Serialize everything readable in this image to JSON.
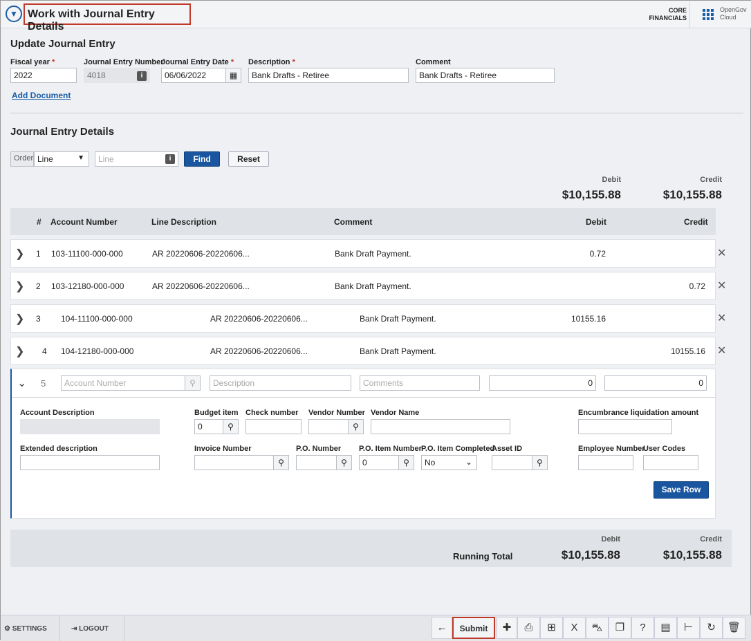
{
  "header": {
    "title": "Work with Journal Entry Details",
    "product_line1": "CORE",
    "product_line2": "FINANCIALS",
    "brand_line1": "OpenGov",
    "brand_line2": "Cloud"
  },
  "update": {
    "heading": "Update Journal Entry",
    "fiscal_year": {
      "label": "Fiscal year",
      "value": "2022"
    },
    "je_number": {
      "label": "Journal Entry Number",
      "value": "4018"
    },
    "je_date": {
      "label": "Journal Entry Date",
      "value": "06/06/2022"
    },
    "description": {
      "label": "Description",
      "value": "Bank Drafts - Retiree"
    },
    "comment": {
      "label": "Comment",
      "value": "Bank Drafts - Retiree"
    },
    "add_document": "Add Document"
  },
  "details": {
    "heading": "Journal Entry Details",
    "order_label": "Order",
    "order_value": "Line",
    "line_placeholder": "Line",
    "find": "Find",
    "reset": "Reset",
    "debit_label": "Debit",
    "credit_label": "Credit",
    "debit_total": "$10,155.88",
    "credit_total": "$10,155.88",
    "columns": [
      "#",
      "Account Number",
      "Line Description",
      "Comment",
      "Debit",
      "Credit"
    ],
    "rows": [
      {
        "n": "1",
        "account": "103-11100-000-000",
        "desc": "AR 20220606-20220606...",
        "comment": "Bank Draft Payment.",
        "debit": "0.72",
        "credit": ""
      },
      {
        "n": "2",
        "account": "103-12180-000-000",
        "desc": "AR 20220606-20220606...",
        "comment": "Bank Draft Payment.",
        "debit": "",
        "credit": "0.72"
      },
      {
        "n": "3",
        "account": "104-11100-000-000",
        "desc": "AR 20220606-20220606...",
        "comment": "Bank Draft Payment.",
        "debit": "10155.16",
        "credit": ""
      },
      {
        "n": "4",
        "account": "104-12180-000-000",
        "desc": "AR 20220606-20220606...",
        "comment": "Bank Draft Payment.",
        "debit": "",
        "credit": "10155.16"
      }
    ],
    "new_row": {
      "n": "5",
      "account_ph": "Account Number",
      "desc_ph": "Description",
      "comments_ph": "Comments",
      "debit": "0",
      "credit": "0"
    },
    "expanded": {
      "account_description": "Account Description",
      "budget_item": "Budget item",
      "budget_value": "0",
      "check_number": "Check number",
      "vendor_number": "Vendor Number",
      "vendor_name": "Vendor Name",
      "encumbrance": "Encumbrance liquidation amount",
      "extended_description": "Extended description",
      "invoice_number": "Invoice Number",
      "po_number": "P.O. Number",
      "po_item_number": "P.O. Item Number",
      "po_item_value": "0",
      "po_item_completed": "P.O. Item Completed",
      "po_item_completed_value": "No",
      "asset_id": "Asset ID",
      "employee_number": "Employee Number",
      "user_codes": "User Codes",
      "save_row": "Save Row"
    },
    "running": {
      "label": "Running Total",
      "debit_label": "Debit",
      "credit_label": "Credit",
      "debit": "$10,155.88",
      "credit": "$10,155.88"
    }
  },
  "footer": {
    "settings": "SETTINGS",
    "logout": "LOGOUT",
    "submit": "Submit"
  },
  "colors": {
    "accent": "#1a56a0",
    "highlight": "#c0392b"
  }
}
